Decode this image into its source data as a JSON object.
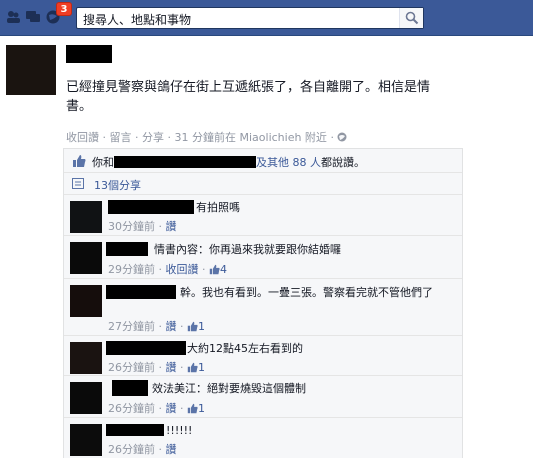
{
  "topbar": {
    "notification_count": "3",
    "search_placeholder": "搜尋人、地點和事物"
  },
  "post": {
    "text": "已經撞見警察與鴿仔在街上互遞紙張了，各自離開了。相信是情書。",
    "actions": {
      "recall": "收回讚",
      "comment": "留言",
      "share": "分享",
      "time_place": "31 分鐘前在 Miaolichieh 附近"
    }
  },
  "likes": {
    "prefix": "你和",
    "suffix_link": "及其他 88 人",
    "suffix": "都說讚。"
  },
  "shares": {
    "label": "13個分享"
  },
  "comments": [
    {
      "text": "有拍照嗎",
      "time": "30分鐘前",
      "action": "讚",
      "likes": ""
    },
    {
      "text": "情書內容：你再過來我就要跟你結婚囉",
      "time": "29分鐘前",
      "action": "收回讚",
      "likes": "4"
    },
    {
      "text": "幹。我也有看到。一疊三張。警察看完就不管他們了",
      "time": "27分鐘前",
      "action": "讚",
      "likes": "1"
    },
    {
      "text": "大約12點45左右看到的",
      "time": "26分鐘前",
      "action": "讚",
      "likes": "1"
    },
    {
      "text": "效法美江：絕對要燒毀這個體制",
      "time": "26分鐘前",
      "action": "讚",
      "likes": "1"
    },
    {
      "text": "!!!!!!",
      "time": "26分鐘前",
      "action": "讚",
      "likes": ""
    }
  ],
  "colors": {
    "brand": "#3b5998",
    "link": "#3b5998",
    "meta": "#9197a3",
    "badge": "#f03d25"
  }
}
